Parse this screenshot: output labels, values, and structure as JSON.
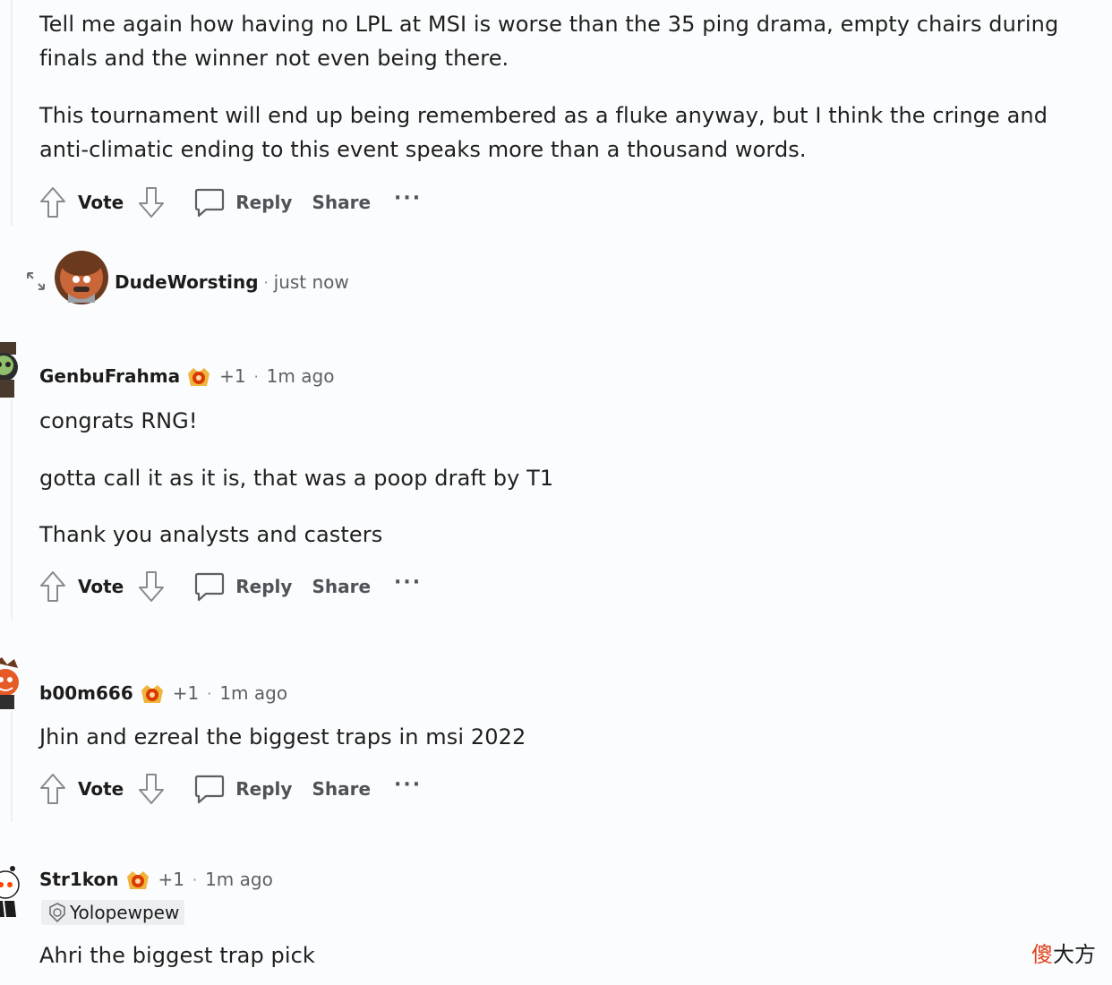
{
  "comment_top": {
    "paragraph_1": "Tell me again how having no LPL at MSI is worse than the 35 ping drama, empty chairs during finals and the winner not even being there.",
    "paragraph_2": "This tournament will end up being remembered as a fluke anyway, but I think the cringe and anti-climatic ending to this event speaks more than a thousand words."
  },
  "actions": {
    "vote": "Vote",
    "reply": "Reply",
    "share": "Share",
    "more": "···"
  },
  "collapsed_user": {
    "username": "DudeWorsting",
    "separator": "·",
    "time": "just now"
  },
  "comments": [
    {
      "username": "GenbuFrahma",
      "score": "+1",
      "separator": "·",
      "time": "1m ago",
      "paragraphs": [
        "congrats RNG!",
        "gotta call it as it is, that was a poop draft by T1",
        "Thank you analysts and casters"
      ]
    },
    {
      "username": "b00m666",
      "score": "+1",
      "separator": "·",
      "time": "1m ago",
      "paragraphs": [
        "Jhin and ezreal the biggest traps in msi 2022"
      ]
    },
    {
      "username": "Str1kon",
      "score": "+1",
      "separator": "·",
      "time": "1m ago",
      "flair": "Yolopewpew",
      "paragraphs": [
        "Ahri the biggest trap pick"
      ]
    }
  ],
  "watermark": {
    "first": "傻",
    "rest": "大方"
  },
  "icons": [
    "upvote-arrow-icon",
    "downvote-arrow-icon",
    "comment-bubble-icon",
    "more-dots-icon",
    "award-icon",
    "expand-icon",
    "avatar"
  ],
  "colors": {
    "background": "#fbfcfd",
    "text": "#1c1c1c",
    "meta": "#5c6166",
    "award_red": "#d93a00",
    "award_gold": "#f0b43c",
    "watermark_red": "#e0431d"
  }
}
